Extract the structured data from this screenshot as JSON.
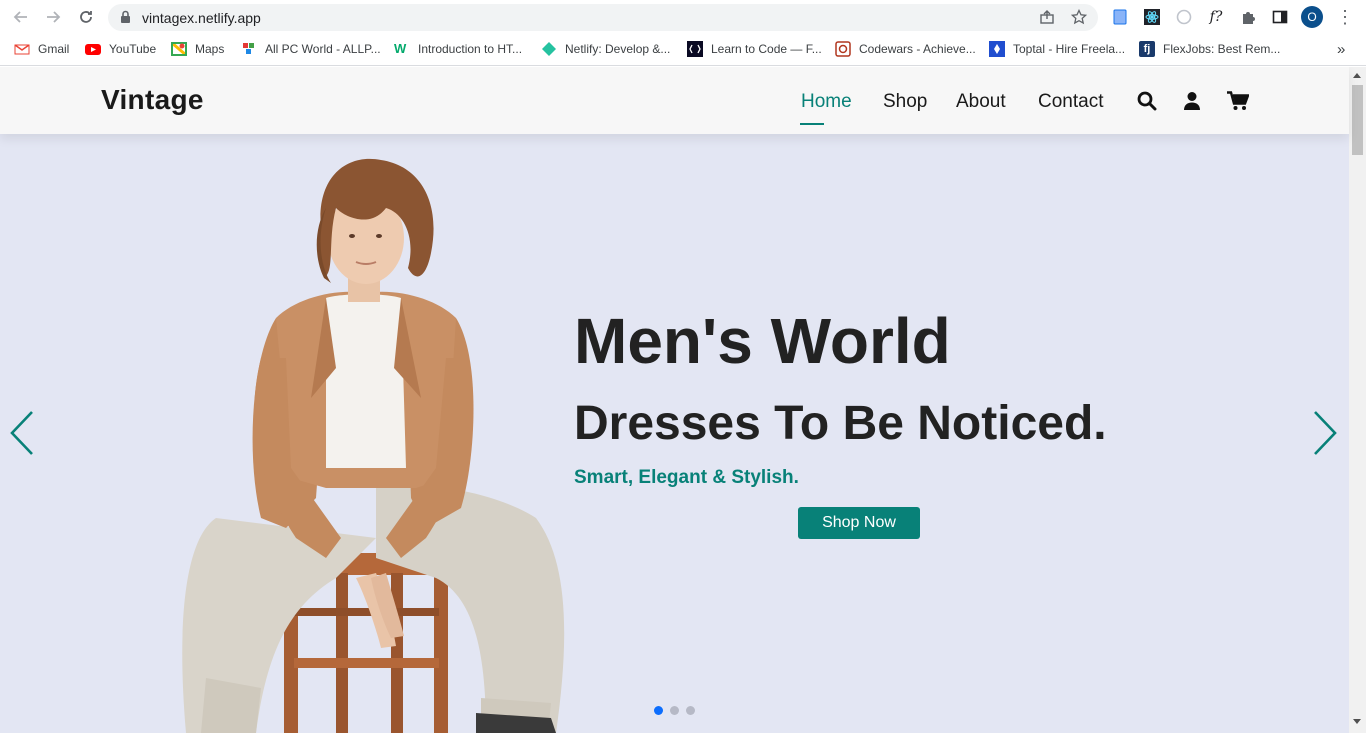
{
  "browser": {
    "url": "vintagex.netlify.app",
    "profile_initial": "O",
    "bookmarks": [
      {
        "label": "Gmail",
        "icon": "gmail-icon",
        "color": "#ea4335"
      },
      {
        "label": "YouTube",
        "icon": "youtube-icon",
        "color": "#ff0000"
      },
      {
        "label": "Maps",
        "icon": "maps-icon",
        "color": "#34a853"
      },
      {
        "label": "All PC World - ALLP...",
        "icon": "allpcworld-icon",
        "color": "#e53935"
      },
      {
        "label": "Introduction to HT...",
        "icon": "w3schools-icon",
        "color": "#04aa6d"
      },
      {
        "label": "Netlify: Develop &...",
        "icon": "netlify-icon",
        "color": "#25c2a0"
      },
      {
        "label": "Learn to Code — F...",
        "icon": "freecodecamp-icon",
        "color": "#0a0a23"
      },
      {
        "label": "Codewars - Achieve...",
        "icon": "codewars-icon",
        "color": "#b1361e"
      },
      {
        "label": "Toptal - Hire Freela...",
        "icon": "toptal-icon",
        "color": "#204ecf"
      },
      {
        "label": "FlexJobs: Best Rem...",
        "icon": "flexjobs-icon",
        "color": "#1a3a6b"
      }
    ],
    "more_bookmarks": "»"
  },
  "site": {
    "logo": "Vintage",
    "nav": {
      "home": "Home",
      "shop": "Shop",
      "about": "About",
      "contact": "Contact"
    },
    "accent": "#088178"
  },
  "hero": {
    "title": "Men's World",
    "subtitle": "Dresses To Be Noticed.",
    "tagline": "Smart, Elegant & Stylish.",
    "button": "Shop Now",
    "active_slide": 1,
    "slide_count": 3
  }
}
